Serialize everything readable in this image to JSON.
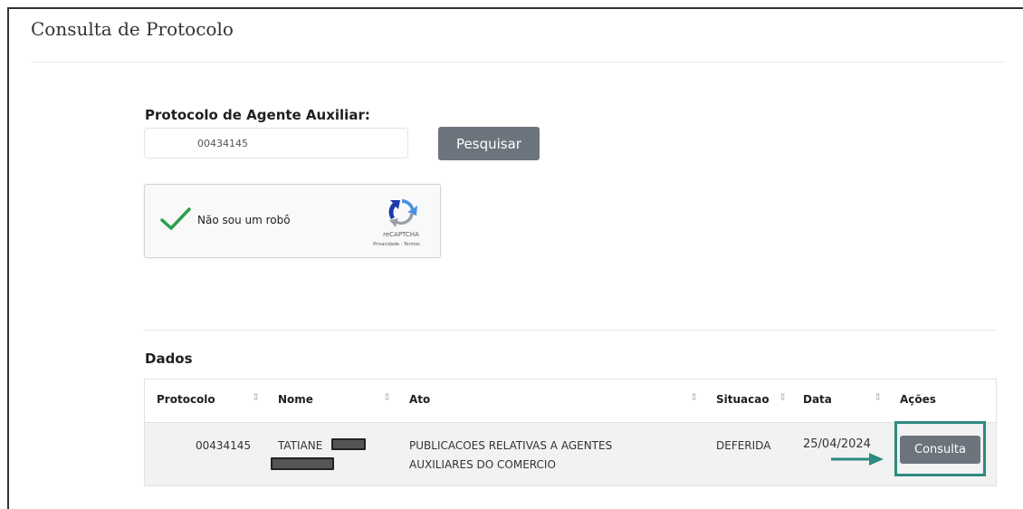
{
  "page": {
    "title": "Consulta de Protocolo"
  },
  "search": {
    "label": "Protocolo de Agente Auxiliar:",
    "value": "00434145",
    "button_label": "Pesquisar"
  },
  "recaptcha": {
    "label": "Não sou um robô",
    "brand": "reCAPTCHA",
    "links": "Privacidade - Termos",
    "checked": true
  },
  "results": {
    "title": "Dados",
    "columns": [
      "Protocolo",
      "Nome",
      "Ato",
      "Situacao",
      "Data",
      "Ações"
    ],
    "rows": [
      {
        "protocolo": "00434145",
        "nome": "TATIANE",
        "ato_line1": "PUBLICACOES RELATIVAS A AGENTES",
        "ato_line2": "AUXILIARES DO COMERCIO",
        "situacao": "DEFERIDA",
        "data": "25/04/2024",
        "action_label": "Consulta"
      }
    ]
  },
  "colors": {
    "button": "#6c757d",
    "highlight": "#2e8b7e",
    "check": "#2aa04a"
  }
}
